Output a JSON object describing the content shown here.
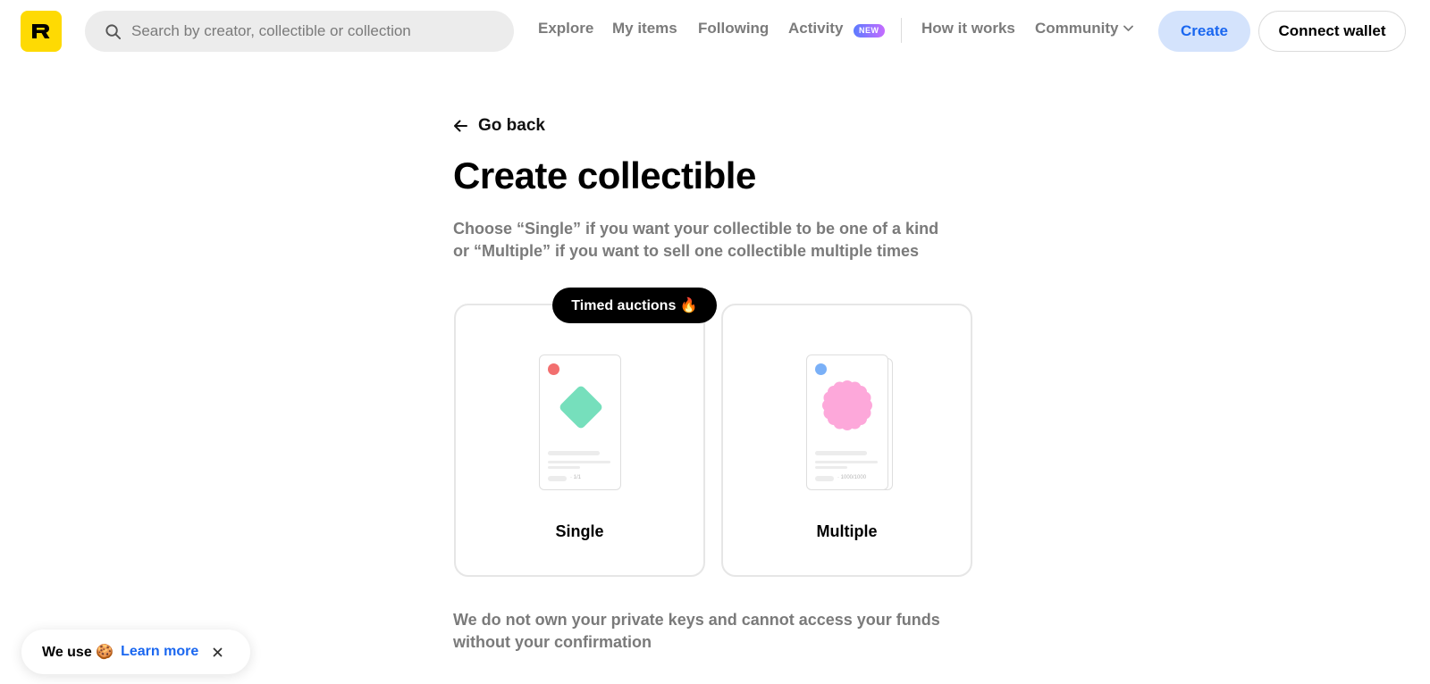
{
  "header": {
    "logo_letter": "R",
    "search_placeholder": "Search by creator, collectible or collection",
    "nav": {
      "explore": "Explore",
      "my_items": "My items",
      "following": "Following",
      "activity": "Activity",
      "activity_badge": "NEW",
      "how_it_works": "How it works",
      "community": "Community"
    },
    "create_label": "Create",
    "connect_wallet_label": "Connect wallet"
  },
  "main": {
    "go_back_label": "Go back",
    "title": "Create collectible",
    "description": "Choose “Single” if you want your collectible to be one of a kind or “Multiple” if you want to sell one collectible multiple times",
    "timed_badge": "Timed auctions 🔥",
    "cards": {
      "single": {
        "label": "Single",
        "edition": "1/1",
        "dot_color": "#f26f6f",
        "art_color": "#76dfbc"
      },
      "multiple": {
        "label": "Multiple",
        "edition": "1000/1000",
        "dot_color": "#7ab0f7",
        "art_color": "#fda8da"
      }
    },
    "footnote": "We do not own your private keys and cannot access your funds without your confirmation"
  },
  "cookie_banner": {
    "text": "We use 🍪",
    "link": "Learn more"
  },
  "colors": {
    "brand_yellow": "#FEDA03",
    "accent_blue": "#1a67f0",
    "create_bg": "#d4e3fc"
  }
}
